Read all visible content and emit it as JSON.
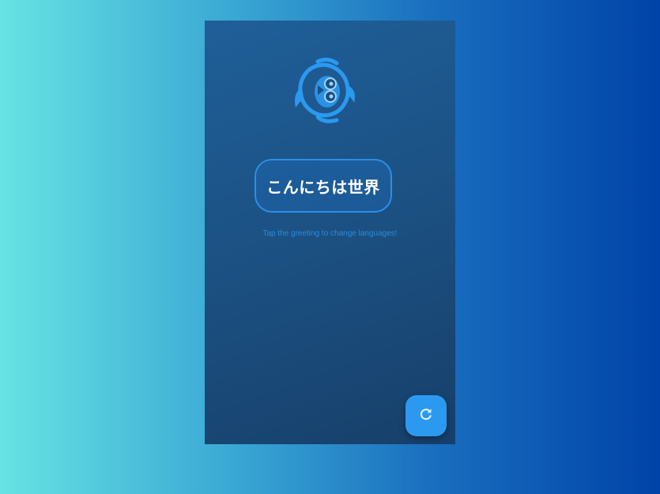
{
  "app": {
    "greeting": "こんにちは世界",
    "hint": "Tap the greeting to change languages!",
    "refresh_icon": "refresh-icon",
    "mascot_icon": "mascot-logo-icon"
  },
  "colors": {
    "accent": "#2b99f0",
    "outline": "#2b8fe6",
    "hint_text": "#2a8bdc",
    "panel_top": "#1f5f99",
    "panel_bottom": "#173f6a"
  }
}
